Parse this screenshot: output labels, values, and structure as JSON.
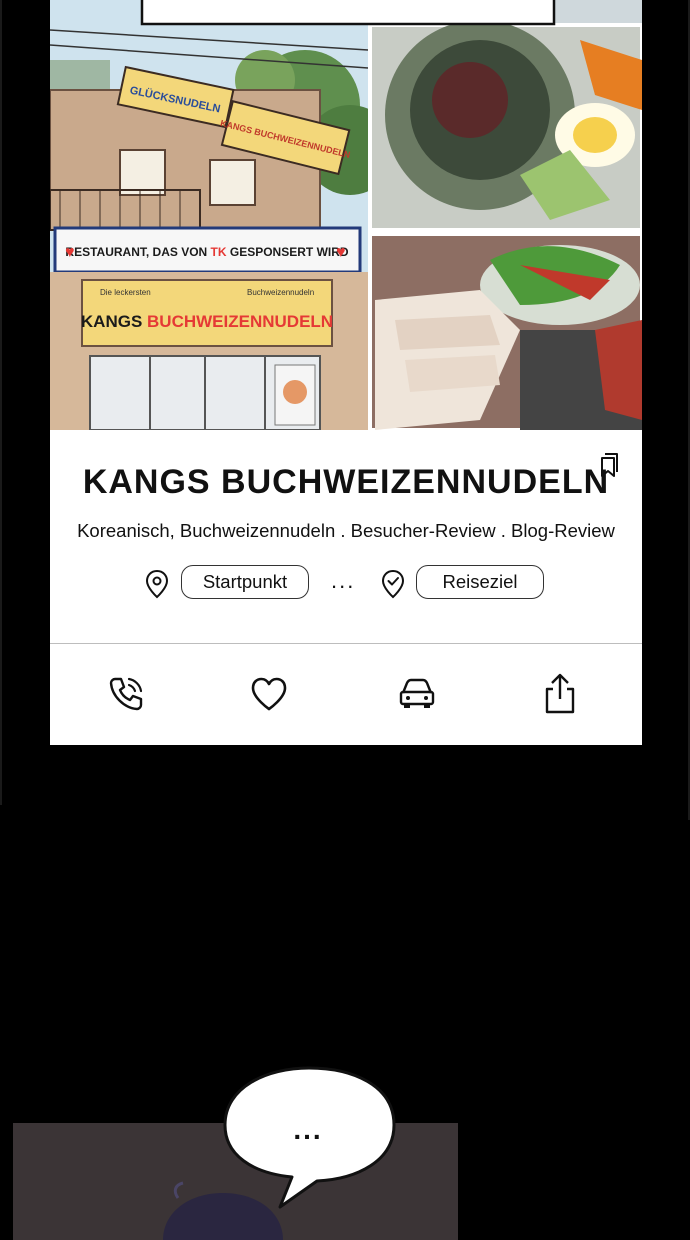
{
  "restaurant": {
    "name": "KANGS BUCHWEIZENNUDELN",
    "tags": "Koreanisch, Buchweizennudeln . Besucher-Review . Blog-Review"
  },
  "banner": {
    "sign_top_left": "GLÜCKSNUDELN",
    "sign_top_right": "KANGS BUCHWEIZENNUDELN",
    "sponsor_banner_pre": "RESTAURANT, DAS VON ",
    "sponsor_banner_tk": "TK",
    "sponsor_banner_post": " GESPONSERT WIRD",
    "shop_sign_left": "Die leckersten",
    "shop_sign_right": "Buchweizennudeln",
    "shop_sign_main_a": "KANGS ",
    "shop_sign_main_b": "BUCHWEIZENNUDELN"
  },
  "route": {
    "start_label": "Startpunkt",
    "separator": "...",
    "destination_label": "Reiseziel"
  },
  "actions": {
    "icons": [
      "phone-icon",
      "heart-icon",
      "car-icon",
      "share-icon"
    ]
  },
  "comic": {
    "speech": "..."
  },
  "colors": {
    "background": "#000000",
    "card": "#ffffff",
    "accent_red": "#e53935",
    "sign_yellow": "#f3d77a"
  }
}
